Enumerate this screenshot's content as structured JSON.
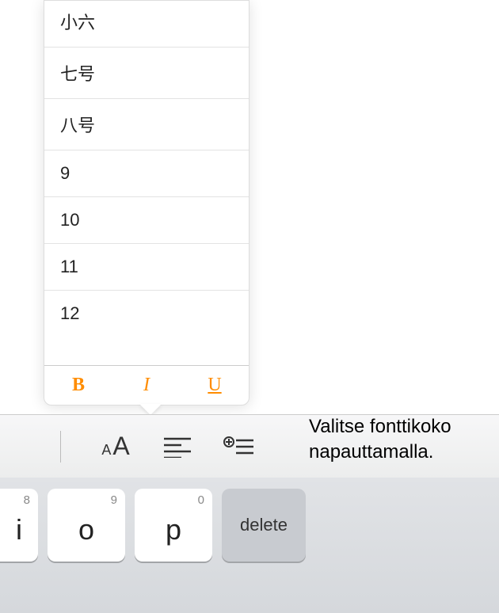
{
  "popover": {
    "sizes": [
      "小六",
      "七号",
      "八号",
      "9",
      "10",
      "11",
      "12"
    ],
    "bold": "B",
    "italic": "I",
    "underline": "U"
  },
  "toolbar": {
    "font_small": "A",
    "font_big": "A"
  },
  "keyboard": {
    "keys": [
      {
        "hint": "8",
        "main": "i",
        "half": true
      },
      {
        "hint": "9",
        "main": "o"
      },
      {
        "hint": "0",
        "main": "p"
      }
    ],
    "delete_label": "delete"
  },
  "callout": {
    "text": "Valitse fonttikoko napauttamalla."
  }
}
